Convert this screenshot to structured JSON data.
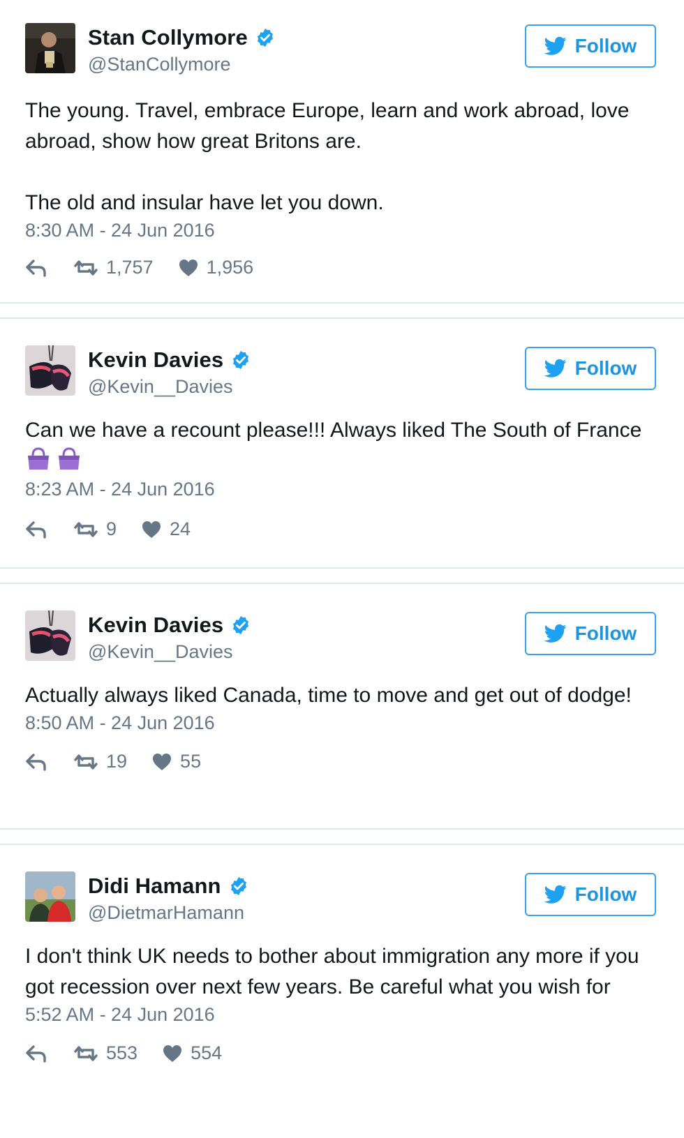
{
  "colors": {
    "accent": "#1b95e0",
    "verified": "#1da1f2",
    "text": "#14171a",
    "muted": "#657786",
    "separator": "#e1e8ed"
  },
  "tweets": [
    {
      "display_name": "Stan Collymore",
      "handle": "@StanCollymore",
      "follow_label": "Follow",
      "text": "The young. Travel, embrace Europe, learn and work abroad, love abroad, show how great Britons are.\n\nThe old and insular have let you down.",
      "emoji": [],
      "timestamp": "8:30 AM - 24 Jun 2016",
      "retweets": "1,757",
      "likes": "1,956"
    },
    {
      "display_name": "Kevin Davies",
      "handle": "@Kevin__Davies",
      "follow_label": "Follow",
      "text": "Can we have a recount please!!! Always liked The South of France ",
      "emoji": [
        "purse-emoji",
        "purse-emoji"
      ],
      "timestamp": "8:23 AM - 24 Jun 2016",
      "retweets": "9",
      "likes": "24"
    },
    {
      "display_name": "Kevin Davies",
      "handle": "@Kevin__Davies",
      "follow_label": "Follow",
      "text": "Actually always liked Canada, time to move and get out of dodge!",
      "emoji": [],
      "timestamp": "8:50 AM - 24 Jun 2016",
      "retweets": "19",
      "likes": "55"
    },
    {
      "display_name": "Didi Hamann",
      "handle": "@DietmarHamann",
      "follow_label": "Follow",
      "text": "I don't think UK needs to bother about immigration any more if you got recession over next few years. Be careful what you wish for",
      "emoji": [],
      "timestamp": "5:52 AM - 24 Jun 2016",
      "retweets": "553",
      "likes": "554"
    }
  ]
}
